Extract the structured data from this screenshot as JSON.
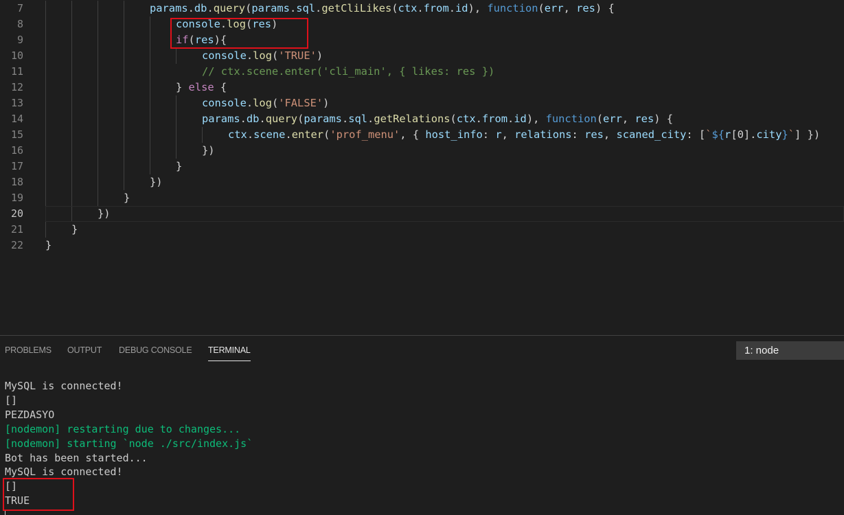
{
  "editor": {
    "lines": [
      {
        "num": "7",
        "tokens": [
          [
            "var",
            "params"
          ],
          [
            "p",
            "."
          ],
          [
            "var",
            "db"
          ],
          [
            "p",
            "."
          ],
          [
            "fn",
            "query"
          ],
          [
            "p",
            "("
          ],
          [
            "var",
            "params"
          ],
          [
            "p",
            "."
          ],
          [
            "var",
            "sql"
          ],
          [
            "p",
            "."
          ],
          [
            "fn",
            "getCliLikes"
          ],
          [
            "p",
            "("
          ],
          [
            "var",
            "ctx"
          ],
          [
            "p",
            "."
          ],
          [
            "var",
            "from"
          ],
          [
            "p",
            "."
          ],
          [
            "var",
            "id"
          ],
          [
            "p",
            "), "
          ],
          [
            "kw",
            "function"
          ],
          [
            "p",
            "("
          ],
          [
            "var",
            "err"
          ],
          [
            "p",
            ", "
          ],
          [
            "var",
            "res"
          ],
          [
            "p",
            ") {"
          ]
        ]
      },
      {
        "num": "8",
        "tokens": [
          [
            "var",
            "console"
          ],
          [
            "p",
            "."
          ],
          [
            "fn",
            "log"
          ],
          [
            "p",
            "("
          ],
          [
            "var",
            "res"
          ],
          [
            "p",
            ")"
          ]
        ]
      },
      {
        "num": "9",
        "tokens": [
          [
            "ctrl",
            "if"
          ],
          [
            "p",
            "("
          ],
          [
            "var",
            "res"
          ],
          [
            "p",
            "){"
          ]
        ]
      },
      {
        "num": "10",
        "tokens": [
          [
            "var",
            "console"
          ],
          [
            "p",
            "."
          ],
          [
            "fn",
            "log"
          ],
          [
            "p",
            "("
          ],
          [
            "str",
            "'TRUE'"
          ],
          [
            "p",
            ")"
          ]
        ]
      },
      {
        "num": "11",
        "tokens": [
          [
            "cmt",
            "// ctx.scene.enter('cli_main', { likes: res })"
          ]
        ]
      },
      {
        "num": "12",
        "tokens": [
          [
            "p",
            "} "
          ],
          [
            "ctrl",
            "else"
          ],
          [
            "p",
            " {"
          ]
        ]
      },
      {
        "num": "13",
        "tokens": [
          [
            "var",
            "console"
          ],
          [
            "p",
            "."
          ],
          [
            "fn",
            "log"
          ],
          [
            "p",
            "("
          ],
          [
            "str",
            "'FALSE'"
          ],
          [
            "p",
            ")"
          ]
        ]
      },
      {
        "num": "14",
        "tokens": [
          [
            "var",
            "params"
          ],
          [
            "p",
            "."
          ],
          [
            "var",
            "db"
          ],
          [
            "p",
            "."
          ],
          [
            "fn",
            "query"
          ],
          [
            "p",
            "("
          ],
          [
            "var",
            "params"
          ],
          [
            "p",
            "."
          ],
          [
            "var",
            "sql"
          ],
          [
            "p",
            "."
          ],
          [
            "fn",
            "getRelations"
          ],
          [
            "p",
            "("
          ],
          [
            "var",
            "ctx"
          ],
          [
            "p",
            "."
          ],
          [
            "var",
            "from"
          ],
          [
            "p",
            "."
          ],
          [
            "var",
            "id"
          ],
          [
            "p",
            "), "
          ],
          [
            "kw",
            "function"
          ],
          [
            "p",
            "("
          ],
          [
            "var",
            "err"
          ],
          [
            "p",
            ", "
          ],
          [
            "var",
            "res"
          ],
          [
            "p",
            ") {"
          ]
        ]
      },
      {
        "num": "15",
        "tokens": [
          [
            "var",
            "ctx"
          ],
          [
            "p",
            "."
          ],
          [
            "var",
            "scene"
          ],
          [
            "p",
            "."
          ],
          [
            "fn",
            "enter"
          ],
          [
            "p",
            "("
          ],
          [
            "str",
            "'prof_menu'"
          ],
          [
            "p",
            ", { "
          ],
          [
            "var",
            "host_info"
          ],
          [
            "p",
            ": "
          ],
          [
            "var",
            "r"
          ],
          [
            "p",
            ", "
          ],
          [
            "var",
            "relations"
          ],
          [
            "p",
            ": "
          ],
          [
            "var",
            "res"
          ],
          [
            "p",
            ", "
          ],
          [
            "var",
            "scaned_city"
          ],
          [
            "p",
            ": ["
          ],
          [
            "str",
            "`"
          ],
          [
            "tmpl",
            "${"
          ],
          [
            "var",
            "r"
          ],
          [
            "p",
            "[0]."
          ],
          [
            "var",
            "city"
          ],
          [
            "tmpl",
            "}"
          ],
          [
            "str",
            "`"
          ],
          [
            "p",
            "] })"
          ]
        ]
      },
      {
        "num": "16",
        "tokens": [
          [
            "p",
            "})"
          ]
        ]
      },
      {
        "num": "17",
        "tokens": [
          [
            "p",
            "}"
          ]
        ]
      },
      {
        "num": "18",
        "tokens": [
          [
            "p",
            "})"
          ]
        ]
      },
      {
        "num": "19",
        "tokens": [
          [
            "p",
            "}"
          ]
        ]
      },
      {
        "num": "20",
        "tokens": [
          [
            "p",
            "})"
          ]
        ]
      },
      {
        "num": "21",
        "tokens": [
          [
            "p",
            "}"
          ]
        ]
      },
      {
        "num": "22",
        "tokens": [
          [
            "p",
            "}"
          ]
        ]
      }
    ]
  },
  "panel": {
    "tabs": [
      "PROBLEMS",
      "OUTPUT",
      "DEBUG CONSOLE",
      "TERMINAL"
    ],
    "active_tab": "TERMINAL",
    "terminal_selector": "1: node",
    "terminal_lines": [
      {
        "text": "MySQL is connected!",
        "color": "default"
      },
      {
        "text": "[]",
        "color": "default"
      },
      {
        "text": "PEZDASYO",
        "color": "default"
      },
      {
        "text": "[nodemon] restarting due to changes...",
        "color": "green"
      },
      {
        "text": "[nodemon] starting `node ./src/index.js`",
        "color": "green"
      },
      {
        "text": "Bot has been started...",
        "color": "default"
      },
      {
        "text": "MySQL is connected!",
        "color": "default"
      },
      {
        "text": "[]",
        "color": "default"
      },
      {
        "text": "TRUE",
        "color": "default"
      }
    ]
  },
  "colors": {
    "background": "#1e1e1e",
    "keyword": "#569cd6",
    "control": "#c586c0",
    "function": "#dcdcaa",
    "variable": "#9cdcfe",
    "string": "#ce9178",
    "comment": "#6a9955",
    "terminal_green": "#0dbc79",
    "highlight_box": "#e0101a"
  }
}
